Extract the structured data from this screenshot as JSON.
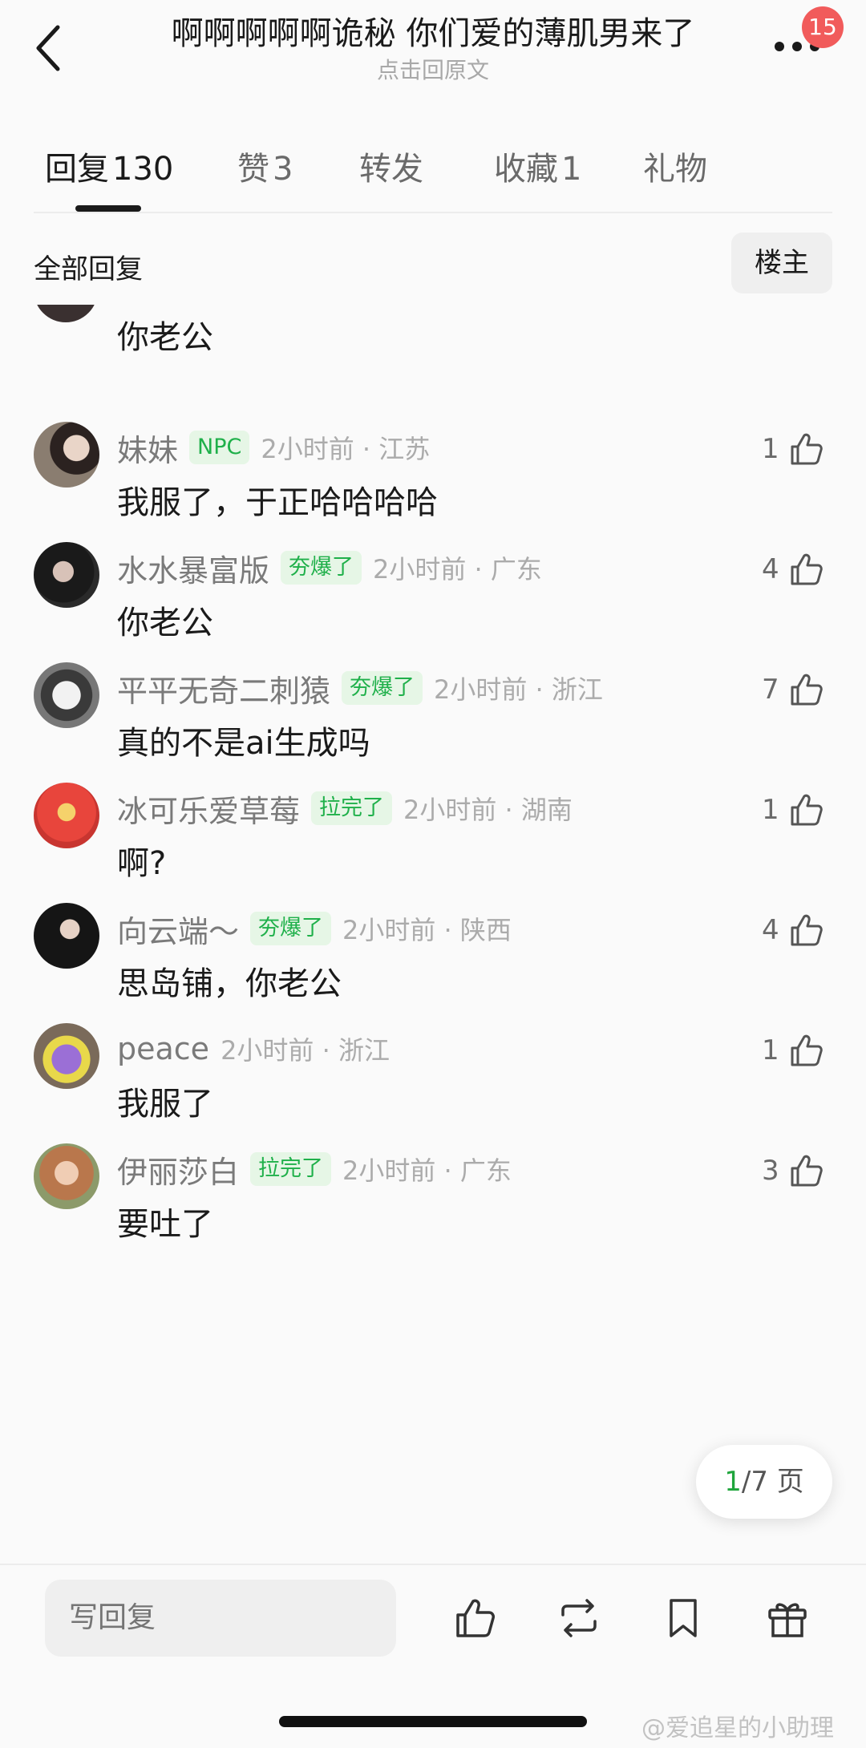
{
  "header": {
    "title": "啊啊啊啊啊诡秘 你们爱的薄肌男来了",
    "subtitle": "点击回原文",
    "badge_count": "15",
    "back_icon": "chevron-left-icon",
    "more_icon": "more-dots-icon"
  },
  "tabs": [
    {
      "label": "回复",
      "count": "130",
      "active": true
    },
    {
      "label": "赞",
      "count": "3",
      "active": false
    },
    {
      "label": "转发",
      "count": "",
      "active": false
    },
    {
      "label": "收藏",
      "count": "1",
      "active": false
    },
    {
      "label": "礼物",
      "count": "",
      "active": false
    }
  ],
  "filter": {
    "title": "全部回复",
    "button": "楼主"
  },
  "partial_comment": {
    "text": "你老公"
  },
  "comments": [
    {
      "name": "妹妹",
      "tag": "NPC",
      "time": "2小时前 · 江苏",
      "text": "我服了，于正哈哈哈哈",
      "likes": "1"
    },
    {
      "name": "水水暴富版",
      "tag": "夯爆了",
      "time": "2小时前 · 广东",
      "text": "你老公",
      "likes": "4"
    },
    {
      "name": "平平无奇二刺猿",
      "tag": "夯爆了",
      "time": "2小时前 · 浙江",
      "text": "真的不是ai生成吗",
      "likes": "7"
    },
    {
      "name": "冰可乐爱草莓",
      "tag": "拉完了",
      "time": "2小时前 · 湖南",
      "text": "啊?",
      "likes": "1"
    },
    {
      "name": "向云端～",
      "tag": "夯爆了",
      "time": "2小时前 · 陕西",
      "text": "思岛铺，你老公",
      "likes": "4"
    },
    {
      "name": "peace",
      "tag": "",
      "time": "2小时前 · 浙江",
      "text": "我服了",
      "likes": "1"
    },
    {
      "name": "伊丽莎白",
      "tag": "拉完了",
      "time": "2小时前 · 广东",
      "text": "要吐了",
      "likes": "3"
    }
  ],
  "pager": {
    "current": "1",
    "rest": "/7 页"
  },
  "bottom_bar": {
    "reply_placeholder": "写回复",
    "icons": [
      "thumbs-up-icon",
      "repost-icon",
      "bookmark-icon",
      "gift-icon"
    ]
  },
  "watermark": "@爱追星的小助理",
  "colors": {
    "accent_green": "#1fb04a",
    "badge_red": "#f15b5b",
    "text_gray": "#7a7a7a"
  }
}
